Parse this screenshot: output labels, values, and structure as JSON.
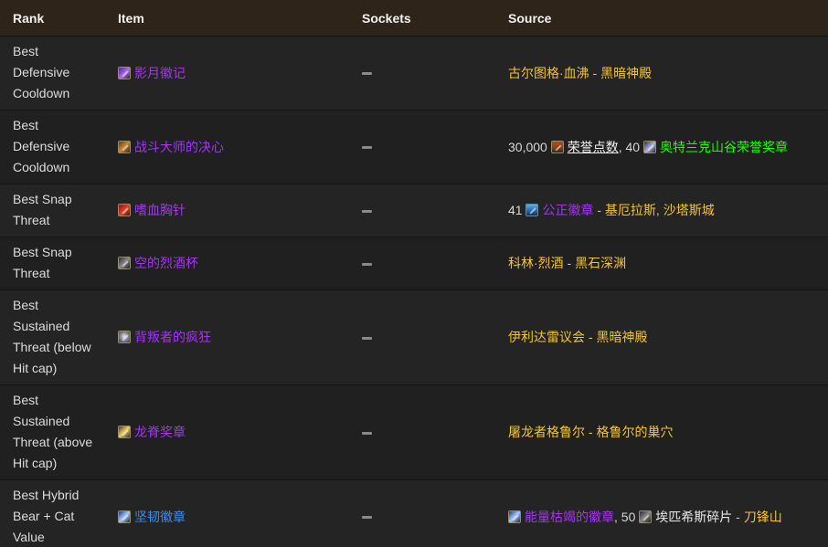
{
  "headers": {
    "rank": "Rank",
    "item": "Item",
    "sockets": "Sockets",
    "source": "Source"
  },
  "rows": [
    {
      "rank_lines": [
        "Best",
        "Defensive",
        "Cooldown"
      ],
      "item": "影月徽记",
      "item_icon": "purple-slash-icon",
      "source": {
        "text1": "古尔图格·血沸",
        "sep": " - ",
        "text2": "黑暗神殿"
      }
    },
    {
      "rank_lines": [
        "Best",
        "Defensive",
        "Cooldown"
      ],
      "item": "战斗大师的决心",
      "item_icon": "brown-figure-icon",
      "source": {
        "amount1": "30,000",
        "currency1": "荣誉点数",
        "comma": ", ",
        "amount2": "40",
        "currency2": "奥特兰克山谷荣誉奖章"
      }
    },
    {
      "rank_lines": [
        "Best Snap",
        "Threat"
      ],
      "item": "嗜血胸针",
      "item_icon": "red-feather-icon",
      "source": {
        "amount1": "41",
        "currency1": "公正徽章",
        "sep": " - ",
        "text1": "基厄拉斯, 沙塔斯城"
      }
    },
    {
      "rank_lines": [
        "Best Snap",
        "Threat"
      ],
      "item": "空的烈酒杯",
      "item_icon": "dark-mug-icon",
      "source": {
        "text1": "科林·烈酒",
        "sep": " - ",
        "text2": "黑石深渊"
      }
    },
    {
      "rank_lines": [
        "Best",
        "Sustained",
        "Threat (below",
        "Hit cap)"
      ],
      "item": "背叛者的疯狂",
      "item_icon": "skull-icon",
      "source": {
        "text1": "伊利达雷议会",
        "sep": " - ",
        "text2": "黑暗神殿"
      }
    },
    {
      "rank_lines": [
        "Best",
        "Sustained",
        "Threat (above",
        "Hit cap)"
      ],
      "item": "龙脊奖章",
      "item_icon": "gold-claw-icon",
      "source": {
        "text1": "屠龙者格鲁尔",
        "sep": " - ",
        "text2": "格鲁尔的巢穴"
      }
    },
    {
      "rank_lines": [
        "Best Hybrid",
        "Bear + Cat",
        "Value"
      ],
      "item": "坚韧徽章",
      "item_icon": "blue-badge-icon",
      "source": {
        "currency1": "能量枯竭的徽章",
        "comma": ", ",
        "amount2": "50",
        "currency2": "埃匹希斯碎片",
        "sep": " - ",
        "text2": "刀锋山"
      }
    }
  ],
  "colors": {
    "header_bg": "#2e2419",
    "row_bg": "#242424",
    "epic": "#a335ee",
    "rare": "#3c8de8",
    "gold": "#f2c433",
    "green": "#1eff00"
  }
}
